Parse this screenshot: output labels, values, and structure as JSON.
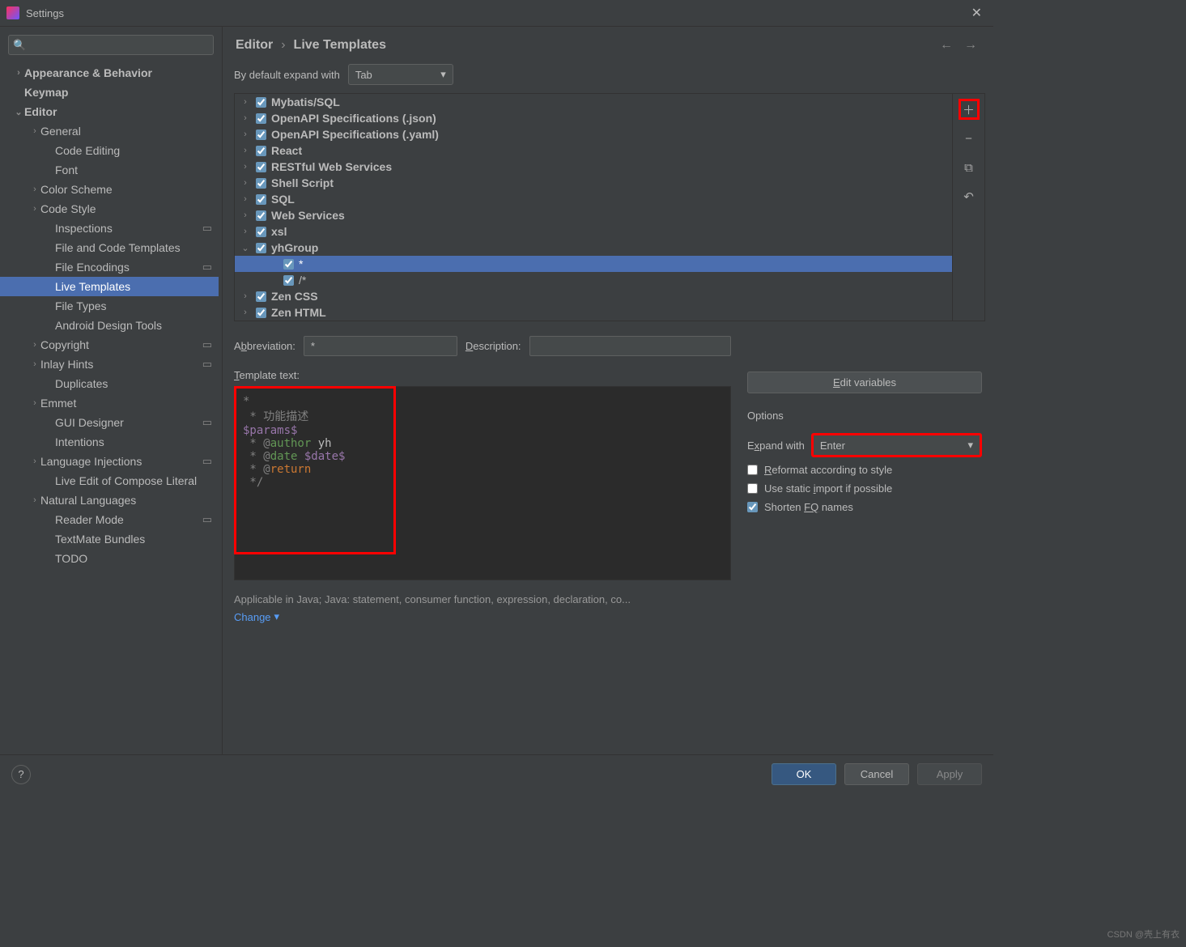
{
  "window": {
    "title": "Settings"
  },
  "search": {
    "placeholder": ""
  },
  "tree": [
    {
      "label": "Appearance & Behavior",
      "indent": 1,
      "chev": "›",
      "bold": true
    },
    {
      "label": "Keymap",
      "indent": 1,
      "bold": true
    },
    {
      "label": "Editor",
      "indent": 1,
      "chev": "⌄",
      "bold": true
    },
    {
      "label": "General",
      "indent": 2,
      "chev": "›"
    },
    {
      "label": "Code Editing",
      "indent": 3
    },
    {
      "label": "Font",
      "indent": 3
    },
    {
      "label": "Color Scheme",
      "indent": 2,
      "chev": "›"
    },
    {
      "label": "Code Style",
      "indent": 2,
      "chev": "›"
    },
    {
      "label": "Inspections",
      "indent": 3,
      "marker": "▭"
    },
    {
      "label": "File and Code Templates",
      "indent": 3
    },
    {
      "label": "File Encodings",
      "indent": 3,
      "marker": "▭"
    },
    {
      "label": "Live Templates",
      "indent": 3,
      "selected": true
    },
    {
      "label": "File Types",
      "indent": 3
    },
    {
      "label": "Android Design Tools",
      "indent": 3
    },
    {
      "label": "Copyright",
      "indent": 2,
      "chev": "›",
      "marker": "▭"
    },
    {
      "label": "Inlay Hints",
      "indent": 2,
      "chev": "›",
      "marker": "▭"
    },
    {
      "label": "Duplicates",
      "indent": 3
    },
    {
      "label": "Emmet",
      "indent": 2,
      "chev": "›"
    },
    {
      "label": "GUI Designer",
      "indent": 3,
      "marker": "▭"
    },
    {
      "label": "Intentions",
      "indent": 3
    },
    {
      "label": "Language Injections",
      "indent": 2,
      "chev": "›",
      "marker": "▭"
    },
    {
      "label": "Live Edit of Compose Literal",
      "indent": 3
    },
    {
      "label": "Natural Languages",
      "indent": 2,
      "chev": "›"
    },
    {
      "label": "Reader Mode",
      "indent": 3,
      "marker": "▭"
    },
    {
      "label": "TextMate Bundles",
      "indent": 3
    },
    {
      "label": "TODO",
      "indent": 3
    }
  ],
  "crumbs": {
    "a": "Editor",
    "b": "Live Templates"
  },
  "expand": {
    "label": "By default expand with",
    "value": "Tab"
  },
  "list": [
    {
      "label": "Mybatis/SQL",
      "chev": "›",
      "checked": true
    },
    {
      "label": "OpenAPI Specifications (.json)",
      "chev": "›",
      "checked": true
    },
    {
      "label": "OpenAPI Specifications (.yaml)",
      "chev": "›",
      "checked": true
    },
    {
      "label": "React",
      "chev": "›",
      "checked": true
    },
    {
      "label": "RESTful Web Services",
      "chev": "›",
      "checked": true
    },
    {
      "label": "Shell Script",
      "chev": "›",
      "checked": true
    },
    {
      "label": "SQL",
      "chev": "›",
      "checked": true
    },
    {
      "label": "Web Services",
      "chev": "›",
      "checked": true
    },
    {
      "label": "xsl",
      "chev": "›",
      "checked": true
    },
    {
      "label": "yhGroup",
      "chev": "⌄",
      "checked": true
    },
    {
      "label": "*",
      "child": true,
      "checked": true,
      "selected": true
    },
    {
      "label": "/*",
      "child": true,
      "checked": true
    },
    {
      "label": "Zen CSS",
      "chev": "›",
      "checked": true
    },
    {
      "label": "Zen HTML",
      "chev": "›",
      "checked": true
    }
  ],
  "labels": {
    "abbr": "Abbreviation:",
    "desc": "Description:",
    "tmpl": "Template text:",
    "edit_vars": "Edit variables",
    "options": "Options",
    "expand": "Expand with",
    "reformat": "Reformat according to style",
    "static": "Use static import if possible",
    "shorten": "Shorten FQ names",
    "applicable": "Applicable in Java; Java: statement, consumer function, expression, declaration, co...",
    "change": "Change"
  },
  "values": {
    "abbr": "*",
    "desc": "",
    "expand_with": "Enter"
  },
  "template": {
    "l1": "*",
    "l2": " * 功能描述",
    "l3": "$params$",
    "l4a": " * @",
    "l4b": "author",
    "l4c": " yh",
    "l5a": " * @",
    "l5b": "date ",
    "l5c": "$date$",
    "l6a": " * @",
    "l6b": "return",
    "l7": " */"
  },
  "footer": {
    "ok": "OK",
    "cancel": "Cancel",
    "apply": "Apply"
  },
  "watermark": "CSDN @壳上有衣"
}
